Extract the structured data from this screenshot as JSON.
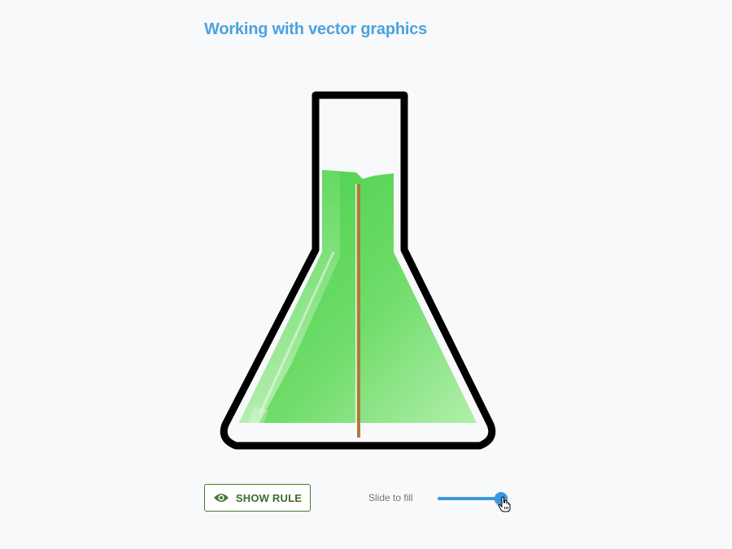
{
  "header": {
    "title": "Working with vector graphics"
  },
  "flask": {
    "fill_level": 0.9
  },
  "controls": {
    "show_rule_label": "SHOW RULE",
    "slider_label": "Slide to fill",
    "slider_value": 0.95
  },
  "icons": {
    "show_rule": "eye-icon",
    "cursor": "hand-pointer-icon"
  },
  "colors": {
    "title": "#4aa3df",
    "liquid": "#56d656",
    "liquid_light": "#b6f0b0",
    "flask_outline": "#000000",
    "button_accent": "#4b7a33",
    "slider_accent": "#3a98e0",
    "rule": "#b07a3a"
  }
}
